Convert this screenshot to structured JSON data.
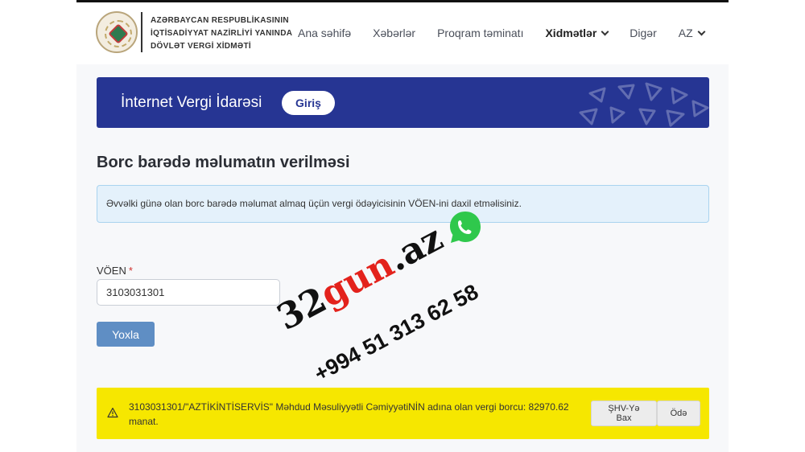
{
  "header": {
    "org_lines": [
      "AZƏRBAYCAN RESPUBLİKASININ",
      "İQTİSADİYYAT NAZİRLİYİ YANINDA",
      "DÖVLƏT VERGİ XİDMƏTİ"
    ],
    "nav": [
      {
        "label": "Ana səhifə"
      },
      {
        "label": "Xəbərlər"
      },
      {
        "label": "Proqram təminatı"
      },
      {
        "label": "Xidmətlər"
      },
      {
        "label": "Digər"
      },
      {
        "label": "AZ"
      }
    ]
  },
  "banner": {
    "title": "İnternet Vergi İdarəsi",
    "login_label": "Giriş"
  },
  "page": {
    "title": "Borc barədə məlumatın verilməsi",
    "info": "Əvvəlki günə olan borc barədə məlumat almaq üçün vergi ödəyicisinin VÖEN-ini daxil etməlisiniz."
  },
  "form": {
    "voen_label": "VÖEN",
    "required_mark": "*",
    "voen_value": "3103031301",
    "check_label": "Yoxla"
  },
  "result": {
    "text": "3103031301/\"AZTİKİNTİSERVİS\" Məhdud Məsuliyyətli CəmiyyətiNİN adına olan vergi borcu: 82970.62 manat.",
    "shv_label": "ŞHV-Yə Bax",
    "pay_label": "Ödə"
  },
  "watermark": {
    "brand_part1": "32",
    "brand_part2": "gun",
    "brand_part3": ".az",
    "phone": "+994 51 313 62 58"
  },
  "colors": {
    "banner": "#263593",
    "warning": "#f6e700",
    "info_bg": "#e4f1fb",
    "button": "#5f8ec4",
    "whatsapp": "#2fc84c",
    "brand_red": "#e3221c"
  }
}
